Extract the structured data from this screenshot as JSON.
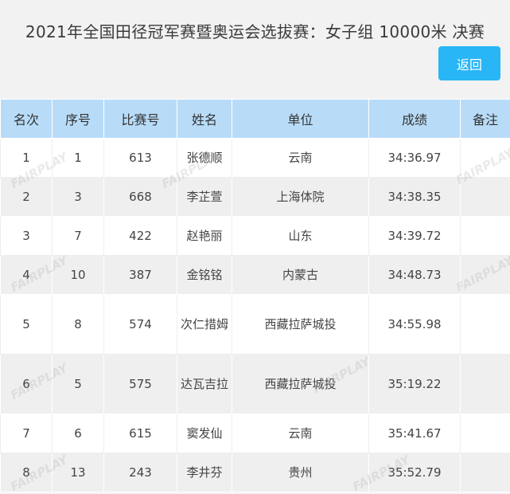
{
  "page": {
    "title": "2021年全国田径冠军赛暨奥运会选拔赛：女子组 10000米 决赛",
    "back_label": "返回",
    "watermark": "FAIRPLAY"
  },
  "table": {
    "headers": [
      "名次",
      "序号",
      "比赛号",
      "姓名",
      "单位",
      "成绩",
      "备注"
    ],
    "rows": [
      {
        "rank": "1",
        "seq": "1",
        "bib": "613",
        "name": "张德顺",
        "unit": "云南",
        "result": "34:36.97",
        "note": ""
      },
      {
        "rank": "2",
        "seq": "3",
        "bib": "668",
        "name": "李芷萱",
        "unit": "上海体院",
        "result": "34:38.35",
        "note": ""
      },
      {
        "rank": "3",
        "seq": "7",
        "bib": "422",
        "name": "赵艳丽",
        "unit": "山东",
        "result": "34:39.72",
        "note": ""
      },
      {
        "rank": "4",
        "seq": "10",
        "bib": "387",
        "name": "金铭铭",
        "unit": "内蒙古",
        "result": "34:48.73",
        "note": ""
      },
      {
        "rank": "5",
        "seq": "8",
        "bib": "574",
        "name": "次仁措姆",
        "unit": "西藏拉萨城投",
        "result": "34:55.98",
        "note": ""
      },
      {
        "rank": "6",
        "seq": "5",
        "bib": "575",
        "name": "达瓦吉拉",
        "unit": "西藏拉萨城投",
        "result": "35:19.22",
        "note": ""
      },
      {
        "rank": "7",
        "seq": "6",
        "bib": "615",
        "name": "窦发仙",
        "unit": "云南",
        "result": "35:41.67",
        "note": ""
      },
      {
        "rank": "8",
        "seq": "13",
        "bib": "243",
        "name": "李井芬",
        "unit": "贵州",
        "result": "35:52.79",
        "note": ""
      }
    ]
  }
}
